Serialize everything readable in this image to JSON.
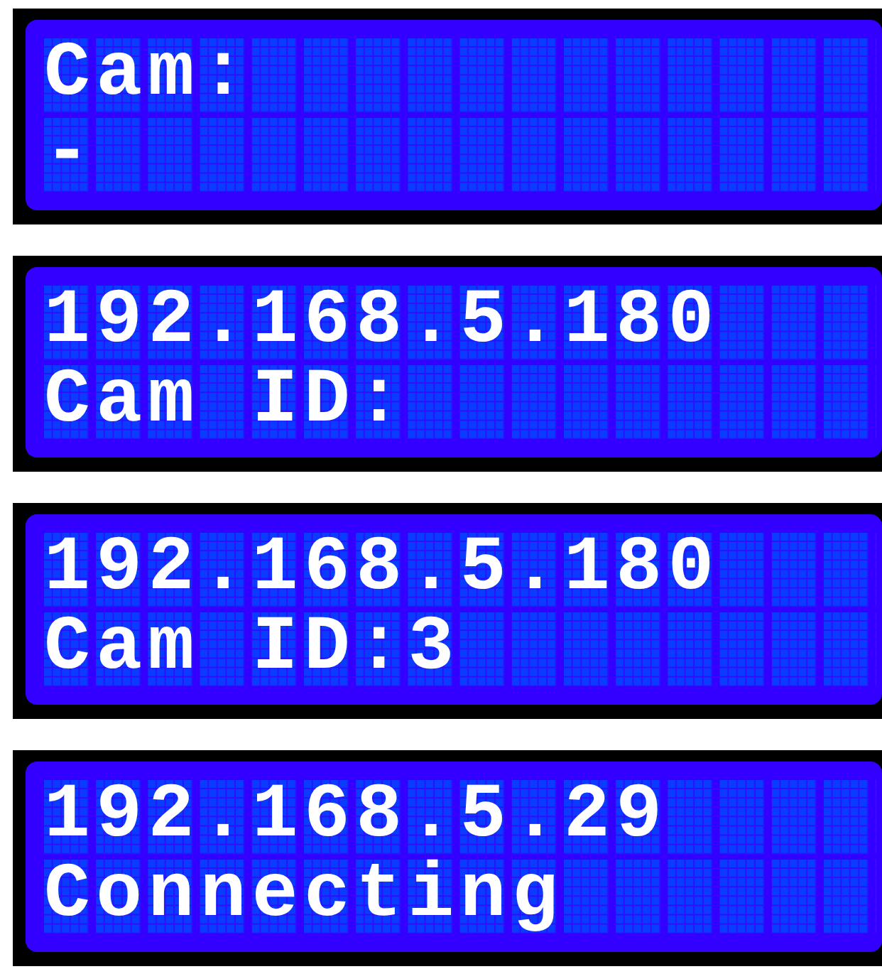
{
  "displays": [
    {
      "line_1": "Cam:",
      "line_2": "-"
    },
    {
      "line_1": "192.168.5.180",
      "line_2": "Cam ID:"
    },
    {
      "line_1": "192.168.5.180",
      "line_2": "Cam ID:3"
    },
    {
      "line_1": "192.168.5.29",
      "line_2": "Connecting"
    }
  ]
}
